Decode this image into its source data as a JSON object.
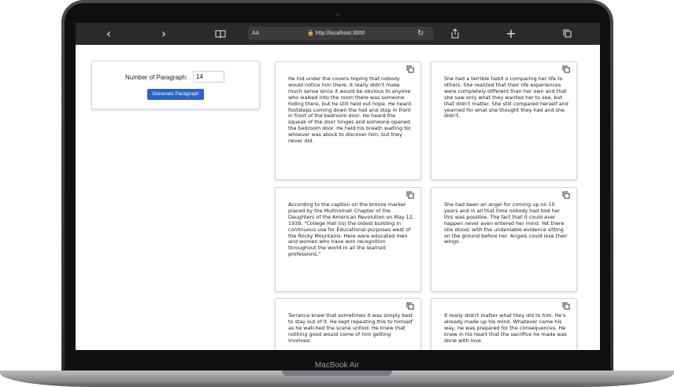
{
  "browser": {
    "nav_back": "‹",
    "nav_forward": "›",
    "bookmarks_icon": "book-icon",
    "address_aa": "AA",
    "url": "🔒 http://localhost:3000",
    "reload": "↻",
    "share": "⇪",
    "new_tab": "+",
    "tabs": "⧉"
  },
  "form": {
    "label": "Number of Paragraph:",
    "value": "14",
    "button": "Generate Paragraph",
    "button_color": "#2962c9"
  },
  "paragraphs": [
    "He hid under the covers hoping that nobody would notice him there. It really didn't make much sense since it would be obvious to anyone who walked into the room there was someone hiding there, but he still held out hope. He heard footsteps coming down the hall and stop in front in front of the bedroom door. He heard the squeak of the door hinges and someone opened the bedroom door. He held his breath waiting for whoever was about to discover him, but they never did.",
    "She had a terrible habit o comparing her life to others. She realized that their life experiences were completely different than her own and that she saw only what they wanted her to see, but that didn't matter. She still compared herself and yearned for what she thought they had and she didn't.",
    "According to the caption on the bronze marker placed by the Multnomah Chapter of the Daughters of the American Revolution on May 12, 1939, \"College Hall (is) the oldest building in continuous use for Educational purposes west of the Rocky Mountains. Here were educated men and women who have won recognition throughout the world in all the learned professions.\"",
    "She had been an angel for coming up on 10 years and in all that time nobody had told her this was possible. The fact that it could ever happen never even entered her mind. Yet there she stood, with the undeniable evidence sitting on the ground before her. Angels could lose their wings.",
    "Terrance knew that sometimes it was simply best to stay out of it. He kept repeating this to himself as he watched the scene unfold. He knew that nothing good would come of him getting involved.",
    "It really didn't matter what they did to him. He's already made up his mind. Whatever came his way, he was prepared for the consequences. He knew in his heart that the sacrifice he made was done with love"
  ],
  "device_label": "MacBook Air"
}
